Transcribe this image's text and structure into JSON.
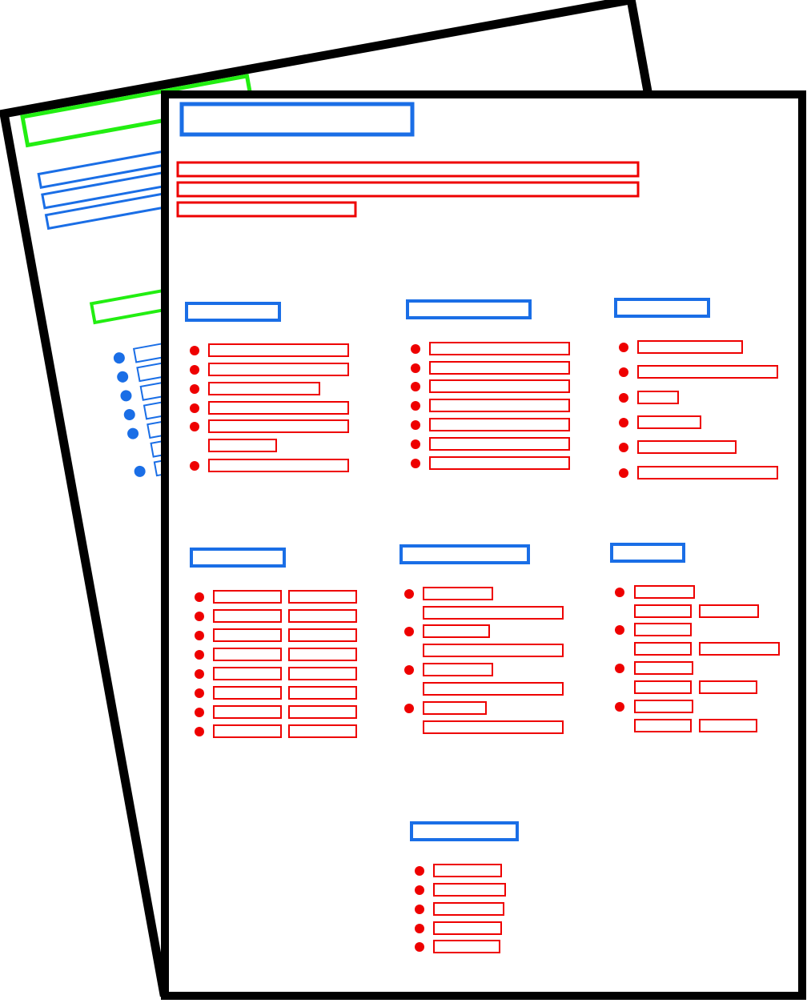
{
  "colors": {
    "outline": "#000000",
    "page_fill": "#ffffff",
    "title_block": "#1a6ee6",
    "text_block": "#ee0000",
    "heading_block_back": "#22ee11",
    "back_text": "#1a6ee6"
  },
  "back_page": {
    "heading_blocks": 3,
    "intro_lines": 3,
    "list_rows": [
      7,
      8
    ]
  },
  "front_page": {
    "title_blocks": 1,
    "intro_lines": 3,
    "sections": [
      {
        "bullets": 6,
        "layout": "single-column"
      },
      {
        "bullets": 7,
        "layout": "single-column"
      },
      {
        "bullets": 6,
        "layout": "single-column"
      },
      {
        "bullets": 8,
        "layout": "two-column"
      },
      {
        "bullets": 4,
        "layout": "stacked-two-line"
      },
      {
        "bullets": 4,
        "layout": "stacked-two-line"
      },
      {
        "bullets": 5,
        "layout": "single-column"
      }
    ]
  }
}
